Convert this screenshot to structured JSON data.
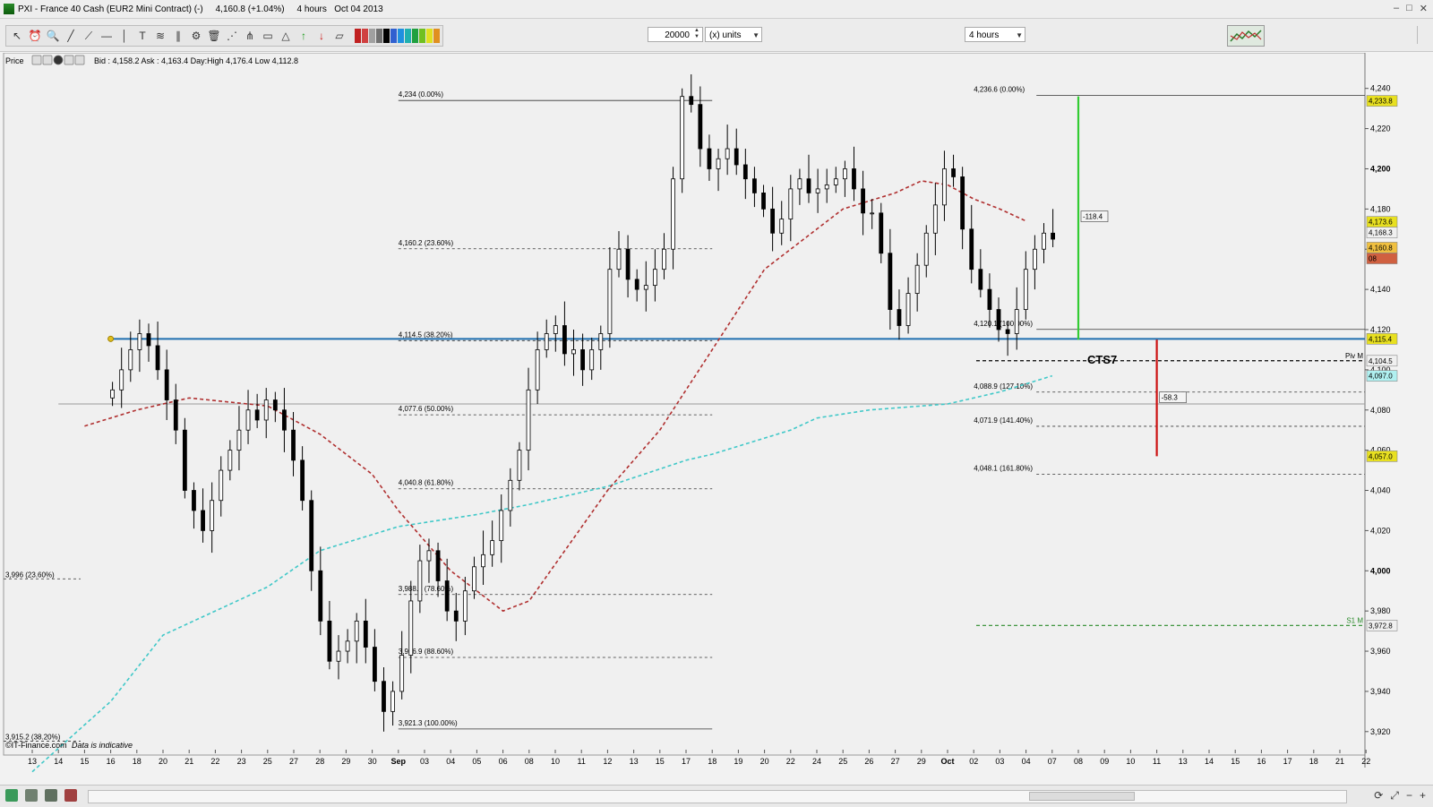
{
  "window": {
    "title": "PXI - France 40 Cash (EUR2 Mini Contract) (-)     4,160.8 (+1.04%)     4 hours   Oct 04 2013",
    "controls": [
      "–",
      "□",
      "✕"
    ]
  },
  "toolbar": {
    "quantity": "20000",
    "units": "(x) units",
    "period": "4 hours",
    "tools": [
      "pointer-icon",
      "alarm-icon",
      "zoom-icon",
      "trendline-icon",
      "ray-icon",
      "horizontal-line-icon",
      "vertical-line-icon",
      "text-icon",
      "fib-icon",
      "channel-icon",
      "settings-icon",
      "trash-icon",
      "fib-fan-icon",
      "pitchfork-icon",
      "rectangle-icon",
      "triangle-icon",
      "buy-arrow-icon",
      "sell-arrow-icon",
      "ruler-icon"
    ],
    "palette_colors": [
      "#c02020",
      "#d04040",
      "#a0a0a0",
      "#707070",
      "#000000",
      "#3060d0",
      "#2090e0",
      "#20b0b0",
      "#20a040",
      "#70c020",
      "#e0e020",
      "#e09020"
    ]
  },
  "chart_header": {
    "label": "Price",
    "quote": "Bid : 4,158.2  Ask : 4,163.4  Day:High 4,176.4  Low 4,112.8"
  },
  "footer": {
    "source": "©IT-Finance.com",
    "note": "Data is indicative"
  },
  "chart_data": {
    "type": "candlestick",
    "instrument": "France 40 Cash (EUR2 Mini Contract)",
    "timeframe": "4 hours",
    "ylim": [
      3911,
      4247
    ],
    "y_ticks": [
      {
        "v": 4240,
        "t": "4,240",
        "b": false
      },
      {
        "v": 4220,
        "t": "4,220",
        "b": false
      },
      {
        "v": 4200,
        "t": "4,200",
        "b": true
      },
      {
        "v": 4180,
        "t": "4,180",
        "b": false
      },
      {
        "v": 4160,
        "t": "4,160",
        "b": false
      },
      {
        "v": 4140,
        "t": "4,140",
        "b": false
      },
      {
        "v": 4120,
        "t": "4,120",
        "b": false
      },
      {
        "v": 4100,
        "t": "4,100",
        "b": false
      },
      {
        "v": 4080,
        "t": "4,080",
        "b": false
      },
      {
        "v": 4060,
        "t": "4,060",
        "b": false
      },
      {
        "v": 4040,
        "t": "4,040",
        "b": false
      },
      {
        "v": 4020,
        "t": "4,020",
        "b": false
      },
      {
        "v": 4000,
        "t": "4,000",
        "b": true
      },
      {
        "v": 3980,
        "t": "3,980",
        "b": false
      },
      {
        "v": 3960,
        "t": "3,960",
        "b": false
      },
      {
        "v": 3940,
        "t": "3,940",
        "b": false
      },
      {
        "v": 3920,
        "t": "3,920",
        "b": false
      }
    ],
    "x_ticks": [
      "13",
      "14",
      "15",
      "16",
      "18",
      "20",
      "21",
      "22",
      "23",
      "25",
      "27",
      "28",
      "29",
      "30",
      "Sep",
      "03",
      "04",
      "05",
      "06",
      "08",
      "10",
      "11",
      "12",
      "13",
      "15",
      "17",
      "18",
      "19",
      "20",
      "22",
      "24",
      "25",
      "26",
      "27",
      "29",
      "Oct",
      "02",
      "03",
      "04",
      "07",
      "08",
      "09",
      "10",
      "11",
      "13",
      "14",
      "15",
      "16",
      "17",
      "18",
      "21",
      "22"
    ],
    "x_ticks_bold": [
      "Sep",
      "Oct"
    ],
    "price_series": [
      4090,
      4100,
      4110,
      4118,
      4112,
      4100,
      4085,
      4070,
      4040,
      4030,
      4020,
      4035,
      4050,
      4060,
      4070,
      4080,
      4075,
      4085,
      4080,
      4070,
      4055,
      4035,
      4000,
      3975,
      3955,
      3960,
      3965,
      3975,
      3962,
      3945,
      3930,
      3940,
      3958,
      3985,
      4005,
      4010,
      3995,
      3980,
      3975,
      3990,
      4002,
      4008,
      4015,
      4030,
      4045,
      4060,
      4090,
      4110,
      4118,
      4122,
      4108,
      4110,
      4100,
      4110,
      4118,
      4150,
      4160,
      4145,
      4140,
      4142,
      4150,
      4160,
      4195,
      4236,
      4232,
      4210,
      4200,
      4205,
      4210,
      4202,
      4195,
      4188,
      4180,
      4168,
      4175,
      4190,
      4195,
      4188,
      4190,
      4192,
      4195,
      4200,
      4190,
      4178,
      4178,
      4158,
      4130,
      4122,
      4138,
      4152,
      4168,
      4182,
      4200,
      4196,
      4170,
      4150,
      4140,
      4130,
      4120,
      4118,
      4130,
      4150,
      4160,
      4168,
      4165
    ],
    "ma_red_dashed": [
      {
        "x": "15",
        "y": 4072
      },
      {
        "x": "18",
        "y": 4080
      },
      {
        "x": "21",
        "y": 4086
      },
      {
        "x": "25",
        "y": 4082
      },
      {
        "x": "28",
        "y": 4068
      },
      {
        "x": "30",
        "y": 4048
      },
      {
        "x": "Sep",
        "y": 4030
      },
      {
        "x": "04",
        "y": 4000
      },
      {
        "x": "06",
        "y": 3980
      },
      {
        "x": "08",
        "y": 3985
      },
      {
        "x": "12",
        "y": 4040
      },
      {
        "x": "15",
        "y": 4070
      },
      {
        "x": "17",
        "y": 4090
      },
      {
        "x": "18",
        "y": 4110
      },
      {
        "x": "20",
        "y": 4150
      },
      {
        "x": "22",
        "y": 4160
      },
      {
        "x": "24",
        "y": 4170
      },
      {
        "x": "25",
        "y": 4180
      },
      {
        "x": "27",
        "y": 4188
      },
      {
        "x": "29",
        "y": 4194
      },
      {
        "x": "Oct",
        "y": 4192
      },
      {
        "x": "02",
        "y": 4185
      },
      {
        "x": "03",
        "y": 4180
      },
      {
        "x": "04",
        "y": 4174
      }
    ],
    "ma_cyan_dashed": [
      {
        "x": "13",
        "y": 3900
      },
      {
        "x": "16",
        "y": 3935
      },
      {
        "x": "20",
        "y": 3968
      },
      {
        "x": "25",
        "y": 3992
      },
      {
        "x": "28",
        "y": 4010
      },
      {
        "x": "30",
        "y": 4018
      },
      {
        "x": "Sep",
        "y": 4022
      },
      {
        "x": "05",
        "y": 4028
      },
      {
        "x": "08",
        "y": 4033
      },
      {
        "x": "12",
        "y": 4042
      },
      {
        "x": "17",
        "y": 4055
      },
      {
        "x": "18",
        "y": 4058
      },
      {
        "x": "20",
        "y": 4066
      },
      {
        "x": "22",
        "y": 4070
      },
      {
        "x": "24",
        "y": 4076
      },
      {
        "x": "26",
        "y": 4080
      },
      {
        "x": "Oct",
        "y": 4083
      },
      {
        "x": "03",
        "y": 4089
      },
      {
        "x": "04",
        "y": 4093
      },
      {
        "x": "07",
        "y": 4097
      }
    ],
    "fib_left": {
      "x_from": "Sep",
      "x_to": "18",
      "levels": [
        {
          "v": 4234.0,
          "t": "4,234 (0.00%)",
          "solid": true
        },
        {
          "v": 4160.2,
          "t": "4,160.2 (23.60%)"
        },
        {
          "v": 4114.5,
          "t": "4,114.5 (38.20%)"
        },
        {
          "v": 4077.6,
          "t": "4,077.6 (50.00%)"
        },
        {
          "v": 4040.8,
          "t": "4,040.8 (61.80%)"
        },
        {
          "v": 3988.2,
          "t": "3,988.2 (78.60%)"
        },
        {
          "v": 3956.9,
          "t": "3,956.9 (88.60%)"
        },
        {
          "v": 3921.3,
          "t": "3,921.3 (100.00%)",
          "solid": true
        }
      ]
    },
    "fib_right": {
      "x_from": "02",
      "x_to": "22",
      "levels": [
        {
          "v": 4236.6,
          "t": "4,236.6 (0.00%)",
          "solid": true
        },
        {
          "v": 4120.1,
          "t": "4,120.1 (100.00%)",
          "solid": true
        },
        {
          "v": 4088.9,
          "t": "4,088.9 (127.10%)"
        },
        {
          "v": 4071.9,
          "t": "4,071.9 (141.40%)"
        },
        {
          "v": 4048.1,
          "t": "4,048.1 (161.80%)"
        }
      ]
    },
    "fib_bottom_left": [
      {
        "v": 3996,
        "t": "3,996 (23.60%)"
      },
      {
        "v": 3915.2,
        "t": "3,915.2 (38.20%)"
      }
    ],
    "horizontal_lines": [
      {
        "v": 4115.4,
        "color": "#1f6fb0",
        "x_from": "16",
        "label": "4,115.4"
      },
      {
        "v": 4083,
        "color": "#9a9a9a",
        "x_from": "14"
      }
    ],
    "pivots": [
      {
        "v": 4104.5,
        "label": "Piv M",
        "price": "4,104.5",
        "color": "#000000"
      },
      {
        "v": 3972.8,
        "label": "S1 M",
        "price": "3,972.8",
        "color": "#2a8a2a"
      }
    ],
    "annotations": [
      {
        "text": "CTS7",
        "x": "08",
        "v": 4103
      },
      {
        "text": "-118.4",
        "x": "08",
        "v": 4175
      },
      {
        "text": "-58.3",
        "x": "11",
        "v": 4085
      }
    ],
    "vertical_measures": [
      {
        "x": "08",
        "from": 4115,
        "to": 4236,
        "color": "#33cc33"
      },
      {
        "x": "11",
        "from": 4115,
        "to": 4057,
        "color": "#cc1111"
      }
    ],
    "price_flags": [
      {
        "v": 4233.8,
        "t": "4,233.8",
        "bg": "#e8e020"
      },
      {
        "v": 4173.6,
        "t": "4,173.6",
        "bg": "#e8e020"
      },
      {
        "v": 4168.3,
        "t": "4,168.3",
        "bg": "#f0f0f0"
      },
      {
        "v": 4160.8,
        "t": "4,160.8",
        "bg": "#f0c040"
      },
      {
        "v": 4155.4,
        "t": "08",
        "bg": "#d06040"
      },
      {
        "v": 4115.4,
        "t": "4,115.4",
        "bg": "#e8e020"
      },
      {
        "v": 4104.5,
        "t": "4,104.5",
        "bg": "#f0f0f0"
      },
      {
        "v": 4097.0,
        "t": "4,097.0",
        "bg": "#b0f0f0"
      },
      {
        "v": 4057.0,
        "t": "4,057.0",
        "bg": "#e8e020"
      },
      {
        "v": 3972.8,
        "t": "3,972.8",
        "bg": "#f0f0f0"
      }
    ],
    "colors": {
      "ma_red": "#b03030",
      "ma_cyan": "#40c8c8",
      "candles": "#000000",
      "grid": "#e0e0e0"
    }
  }
}
